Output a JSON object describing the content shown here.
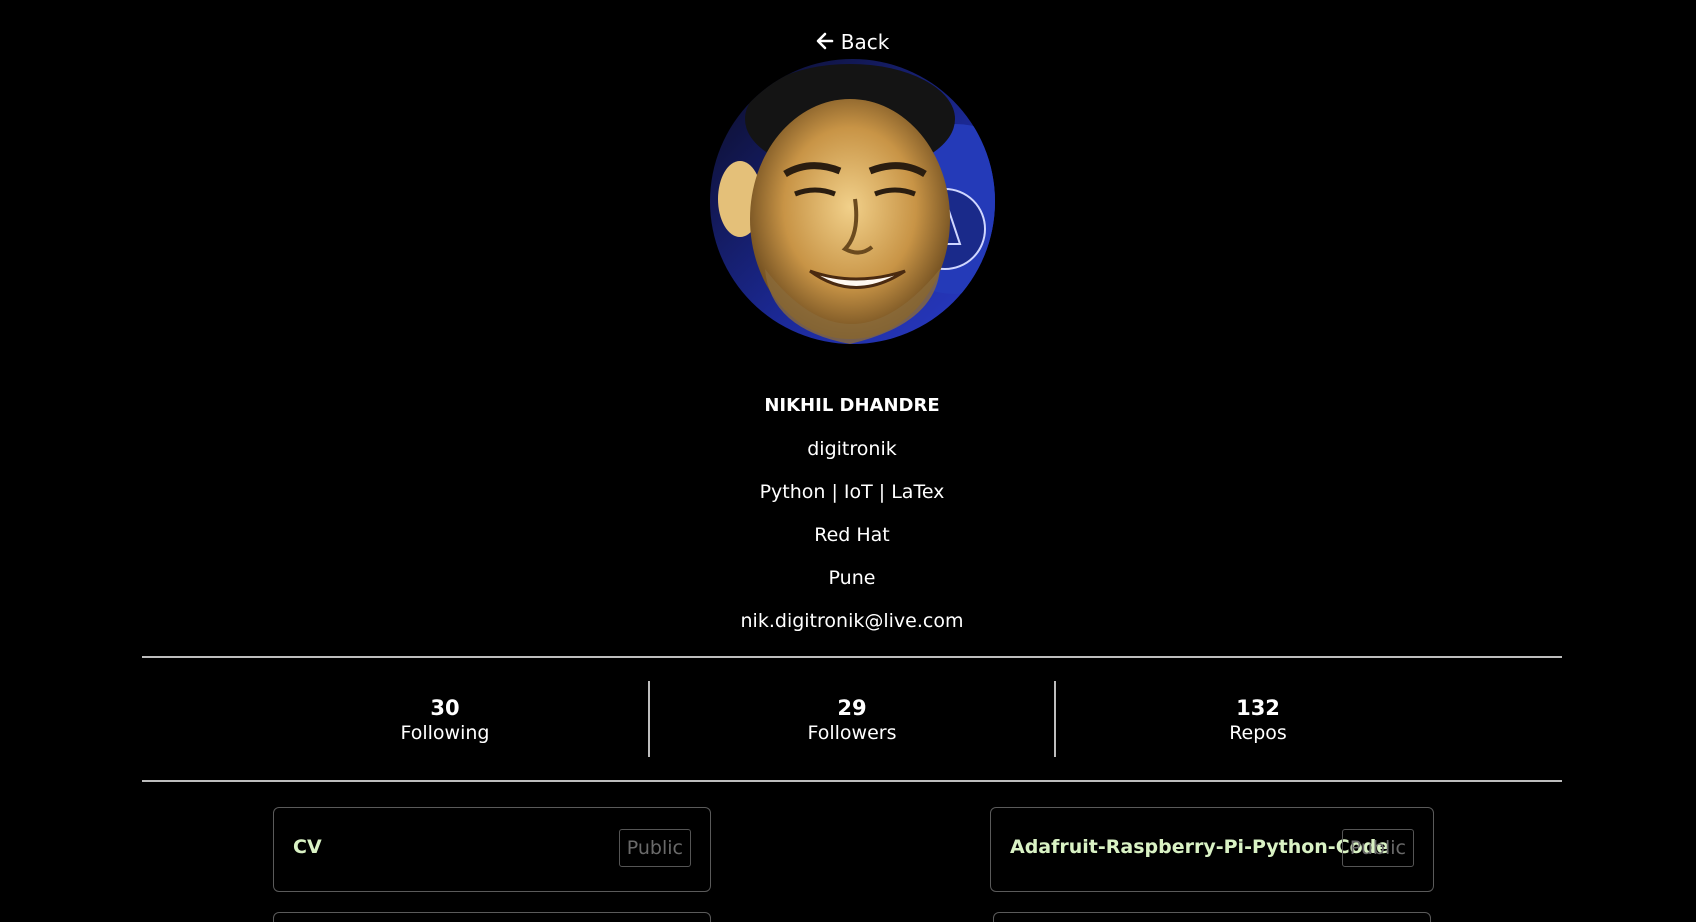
{
  "nav": {
    "back_label": "Back"
  },
  "profile": {
    "name": "NIKHIL DHANDRE",
    "username": "digitronik",
    "bio": "Python | IoT | LaTex",
    "company": "Red Hat",
    "location": "Pune",
    "email": "nik.digitronik@live.com"
  },
  "stats": [
    {
      "value": "30",
      "label": "Following"
    },
    {
      "value": "29",
      "label": "Followers"
    },
    {
      "value": "132",
      "label": "Repos"
    }
  ],
  "repos": [
    {
      "name": "CV",
      "visibility": "Public"
    },
    {
      "name": "Adafruit-Raspberry-Pi-Python-Code",
      "visibility": "Public"
    }
  ],
  "colors": {
    "background": "#000000",
    "text": "#ffffff",
    "repo_name": "#d9f2c4",
    "badge_text": "#6a6a6a",
    "divider": "#bdbdbd"
  },
  "icons": {
    "back": "arrow-left-icon"
  }
}
